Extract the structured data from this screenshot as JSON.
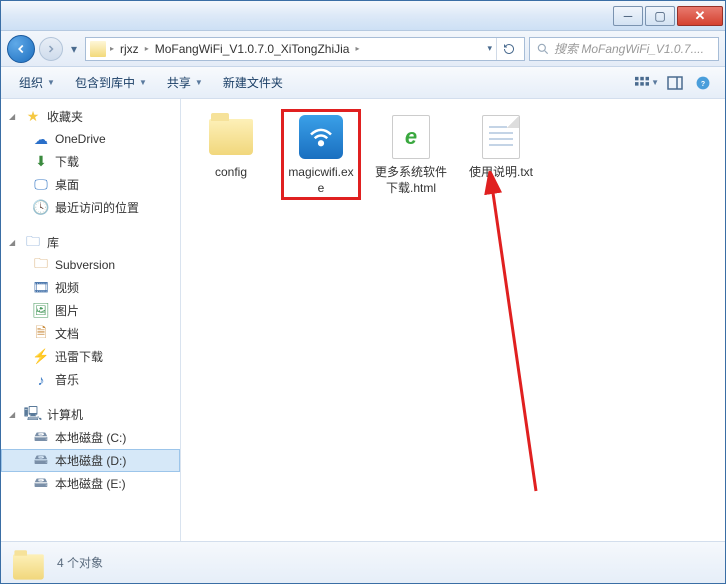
{
  "breadcrumb": {
    "seg1": "rjxz",
    "seg2": "MoFangWiFi_V1.0.7.0_XiTongZhiJia"
  },
  "search": {
    "placeholder": "搜索 MoFangWiFi_V1.0.7...."
  },
  "toolbar": {
    "organize": "组织",
    "include": "包含到库中",
    "share": "共享",
    "newfolder": "新建文件夹"
  },
  "sidebar": {
    "favorites": {
      "header": "收藏夹",
      "items": [
        "OneDrive",
        "下载",
        "桌面",
        "最近访问的位置"
      ]
    },
    "libraries": {
      "header": "库",
      "items": [
        "Subversion",
        "视频",
        "图片",
        "文档",
        "迅雷下载",
        "音乐"
      ]
    },
    "computer": {
      "header": "计算机",
      "items": [
        "本地磁盘 (C:)",
        "本地磁盘 (D:)",
        "本地磁盘 (E:)"
      ],
      "selected": 1
    }
  },
  "files": {
    "items": [
      {
        "name": "config",
        "type": "folder"
      },
      {
        "name": "magicwifi.exe",
        "type": "exe",
        "highlighted": true
      },
      {
        "name": "更多系统软件下载.html",
        "type": "html"
      },
      {
        "name": "使用说明.txt",
        "type": "txt"
      }
    ]
  },
  "status": {
    "count": "4 个对象"
  }
}
